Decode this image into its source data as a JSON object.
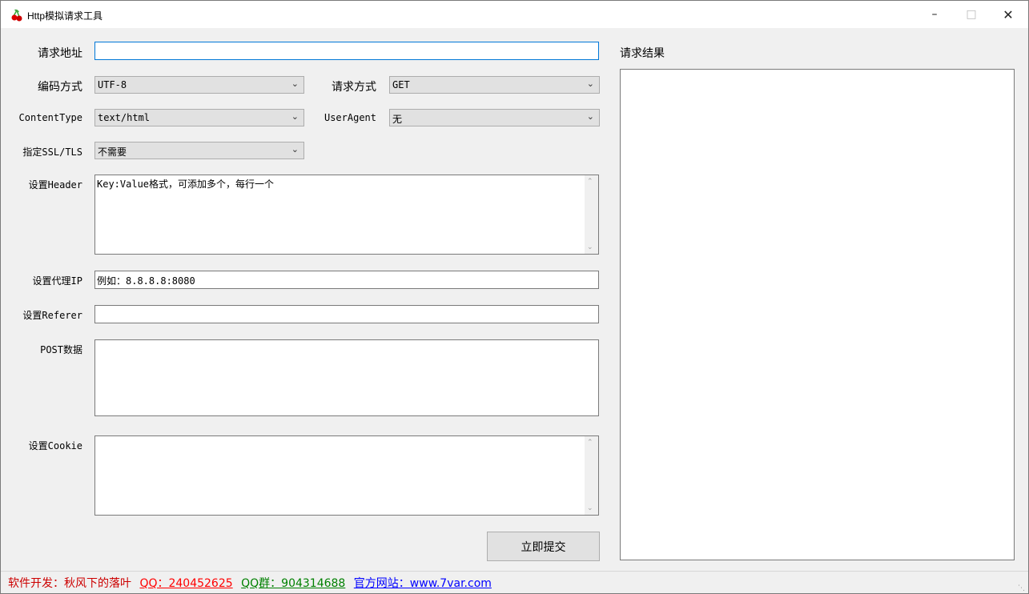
{
  "window": {
    "title": "Http模拟请求工具"
  },
  "form": {
    "url_label": "请求地址",
    "url_value": "",
    "encoding_label": "编码方式",
    "encoding_value": "UTF-8",
    "method_label": "请求方式",
    "method_value": "GET",
    "content_type_label": "ContentType",
    "content_type_value": "text/html",
    "user_agent_label": "UserAgent",
    "user_agent_value": "无",
    "ssl_label": "指定SSL/TLS",
    "ssl_value": "不需要",
    "header_label": "设置Header",
    "header_value": "Key:Value格式，可添加多个，每行一个",
    "proxy_label": "设置代理IP",
    "proxy_value": "例如：8.8.8.8:8080",
    "referer_label": "设置Referer",
    "referer_value": "",
    "post_label": "POST数据",
    "post_value": "",
    "cookie_label": "设置Cookie",
    "cookie_value": "",
    "submit_label": "立即提交"
  },
  "result": {
    "label": "请求结果",
    "value": ""
  },
  "status": {
    "developer": "软件开发：秋风下的落叶",
    "qq": "QQ：240452625",
    "qq_group": "QQ群：904314688",
    "website": "官方网站：www.7var.com",
    "colors": {
      "developer": "#cc0000",
      "qq": "#ff0000",
      "qq_group": "#008000",
      "website": "#0000ff"
    }
  }
}
